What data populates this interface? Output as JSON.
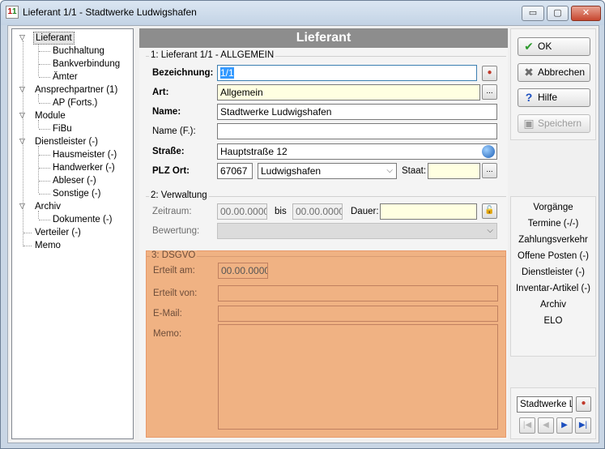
{
  "window": {
    "title": "Lieferant 1/1 - Stadtwerke Ludwigshafen",
    "min_label": "▭",
    "max_label": "▢",
    "close_label": "✕"
  },
  "tree": {
    "items": [
      {
        "label": "Lieferant"
      },
      {
        "label": "Buchhaltung"
      },
      {
        "label": "Bankverbindung"
      },
      {
        "label": "Ämter"
      },
      {
        "label": "Ansprechpartner (1)"
      },
      {
        "label": "AP (Forts.)"
      },
      {
        "label": "Module"
      },
      {
        "label": "FiBu"
      },
      {
        "label": "Dienstleister (-)"
      },
      {
        "label": "Hausmeister (-)"
      },
      {
        "label": "Handwerker (-)"
      },
      {
        "label": "Ableser (-)"
      },
      {
        "label": "Sonstige (-)"
      },
      {
        "label": "Archiv"
      },
      {
        "label": "Dokumente (-)"
      },
      {
        "label": "Verteiler (-)"
      },
      {
        "label": "Memo"
      }
    ]
  },
  "main": {
    "header": "Lieferant",
    "section1": {
      "title": "1: Lieferant 1/1 - ALLGEMEIN",
      "bezeichnung_label": "Bezeichnung:",
      "bezeichnung_value": "1/1",
      "art_label": "Art:",
      "art_value": "Allgemein",
      "name_label": "Name:",
      "name_value": "Stadtwerke Ludwigshafen",
      "namef_label": "Name (F.):",
      "namef_value": "",
      "strasse_label": "Straße:",
      "strasse_value": "Hauptstraße 12",
      "plzort_label": "PLZ Ort:",
      "plz_value": "67067",
      "ort_value": "Ludwigshafen",
      "staat_label": "Staat:",
      "staat_value": "",
      "dots_label": "..."
    },
    "section2": {
      "title": "2: Verwaltung",
      "zeitraum_label": "Zeitraum:",
      "von_value": "00.00.0000",
      "bis_label": "bis",
      "bis_value": "00.00.0000",
      "dauer_label": "Dauer:",
      "dauer_value": "",
      "bewertung_label": "Bewertung:",
      "bewertung_value": ""
    },
    "section3": {
      "title": "3: DSGVO",
      "erteilt_am_label": "Erteilt am:",
      "erteilt_am_value": "00.00.0000",
      "erteilt_von_label": "Erteilt von:",
      "erteilt_von_value": "",
      "email_label": "E-Mail:",
      "email_value": "",
      "memo_label": "Memo:",
      "memo_value": ""
    }
  },
  "actions": {
    "ok": "OK",
    "abbrechen": "Abbrechen",
    "hilfe": "Hilfe",
    "speichern": "Speichern"
  },
  "links": [
    "Vorgänge",
    "Termine (-/-)",
    "Zahlungsverkehr",
    "Offene Posten (-)",
    "Dienstleister (-)",
    "Inventar-Artikel (-)",
    "Archiv",
    "ELO"
  ],
  "nav": {
    "search_value": "Stadtwerke L",
    "first": "|◀",
    "prev": "◀",
    "next": "▶",
    "last": "▶|"
  },
  "colors": {
    "dsgvo_bg": "#f0b283",
    "header_bg": "#8d8d8d",
    "yellow_field": "#ffffe1"
  }
}
